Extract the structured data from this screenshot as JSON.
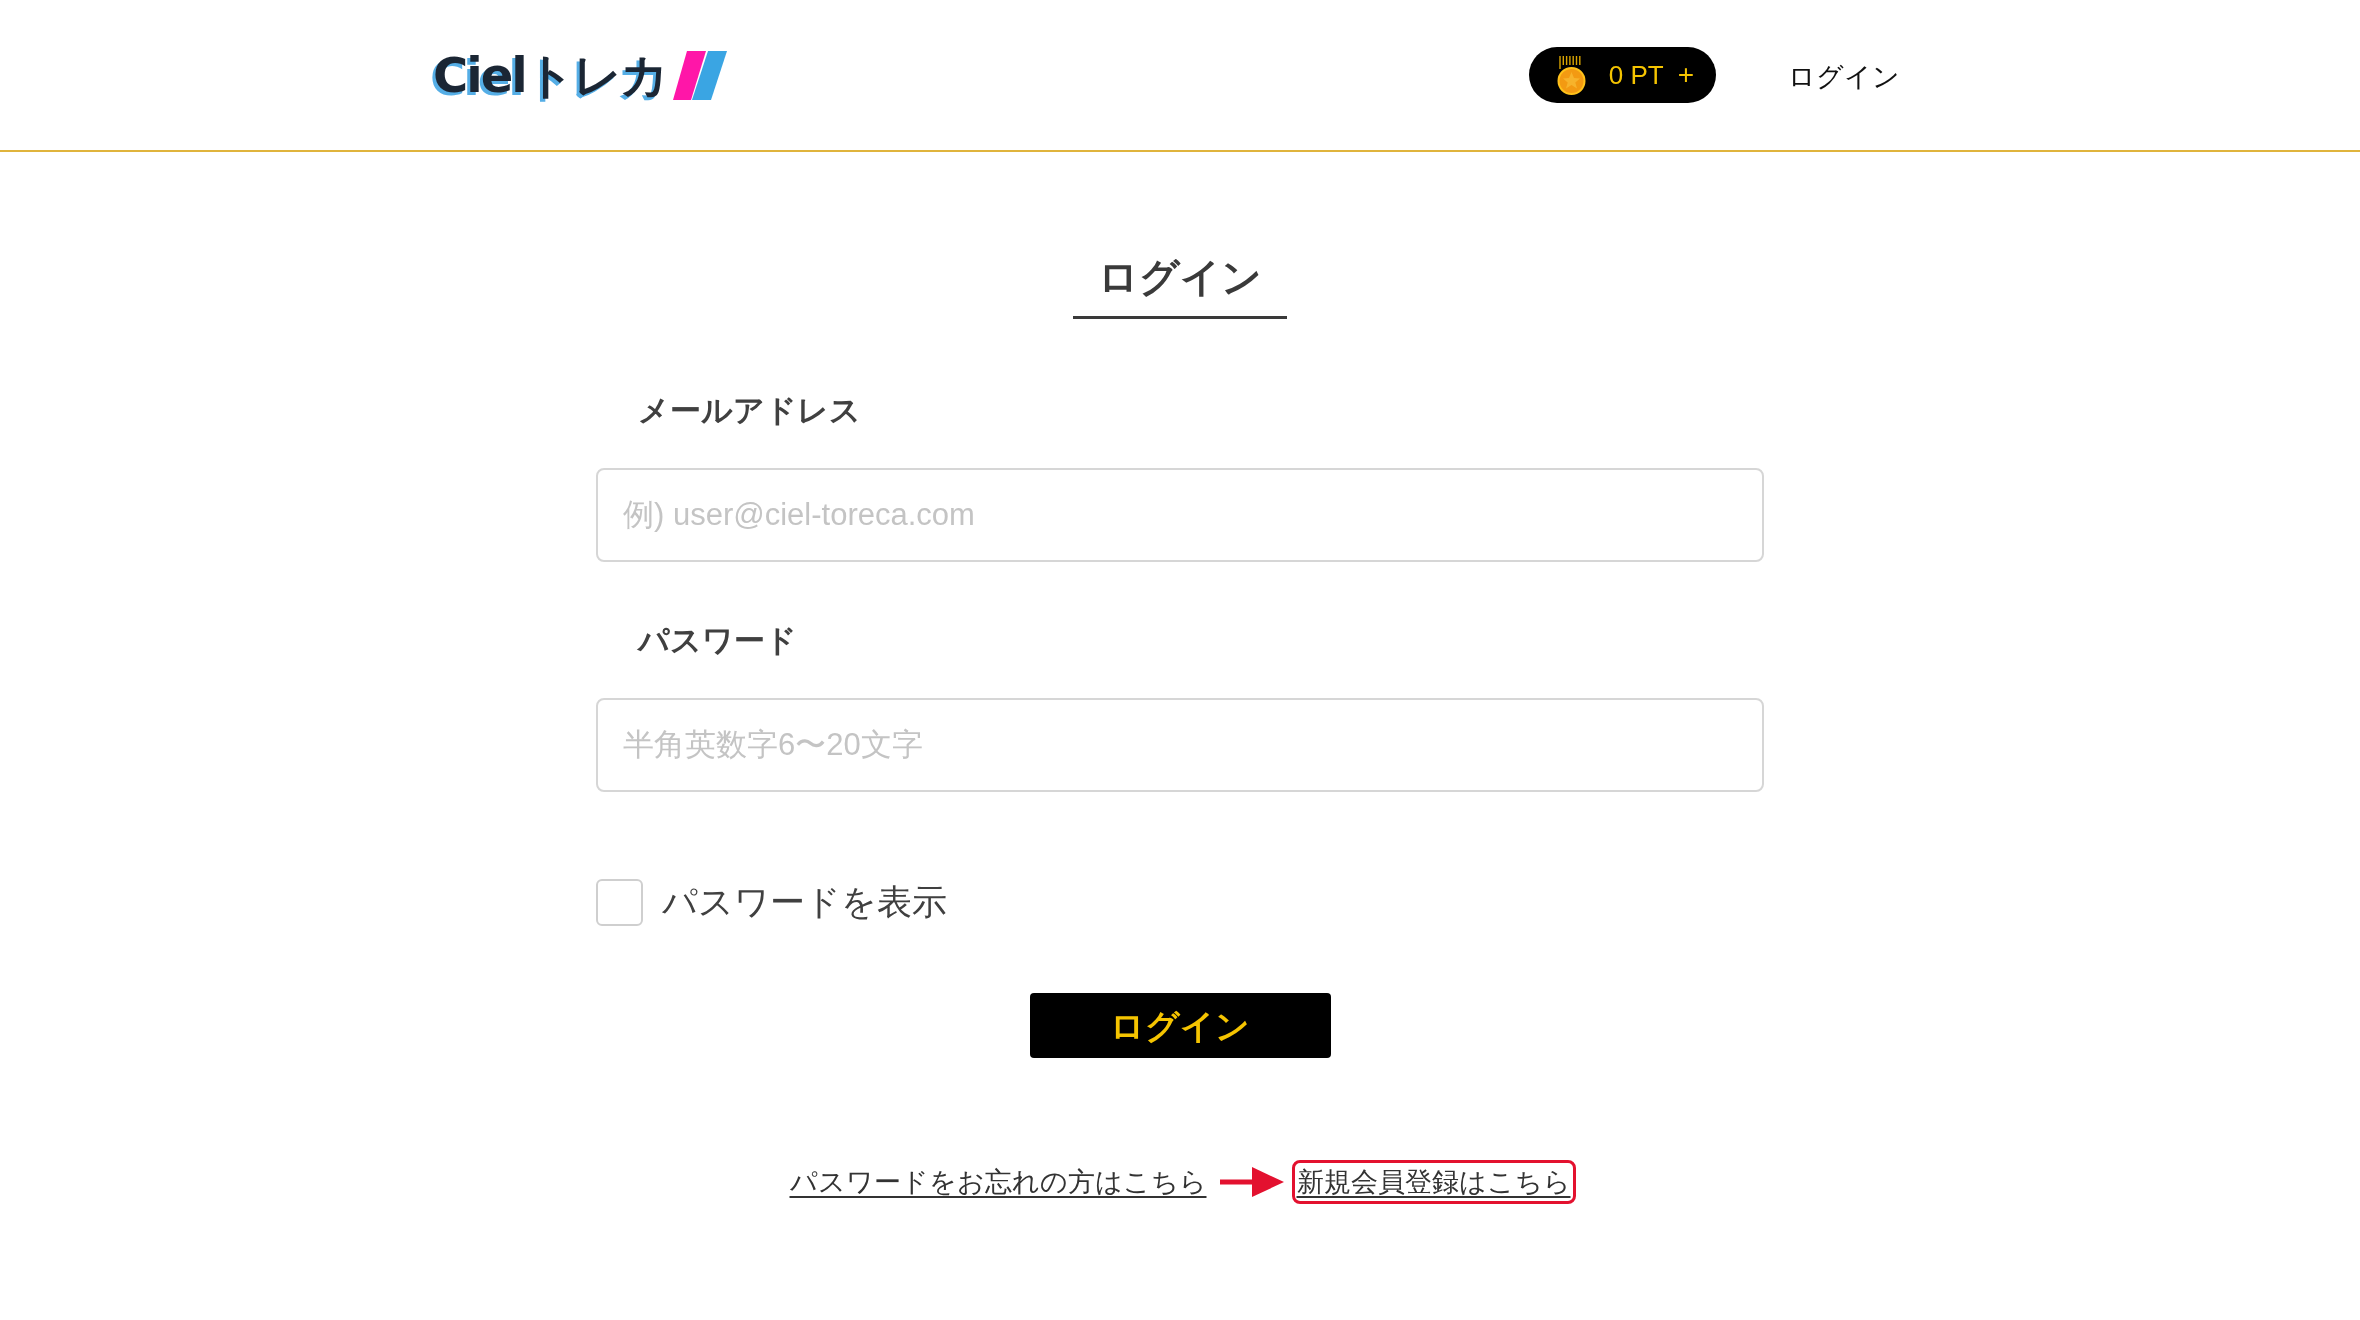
{
  "header": {
    "logo": "Cielトレカ",
    "points": {
      "balance": "0 PT",
      "add_button": "+"
    },
    "login_link": "ログイン"
  },
  "login_form": {
    "title": "ログイン",
    "fields": [
      {
        "label": "メールアドレス",
        "placeholder": "例) user@ciel-toreca.com"
      },
      {
        "label": "パスワード",
        "placeholder": "半角英数字6〜20文字"
      }
    ],
    "show_password": {
      "label": "パスワードを表示",
      "checked": false
    },
    "submit": "ログイン",
    "links": [
      {
        "label": "パスワードをお忘れの方はこちら",
        "highlighted": false
      },
      {
        "label": "新規会員登録はこちら",
        "highlighted": true
      }
    ]
  }
}
